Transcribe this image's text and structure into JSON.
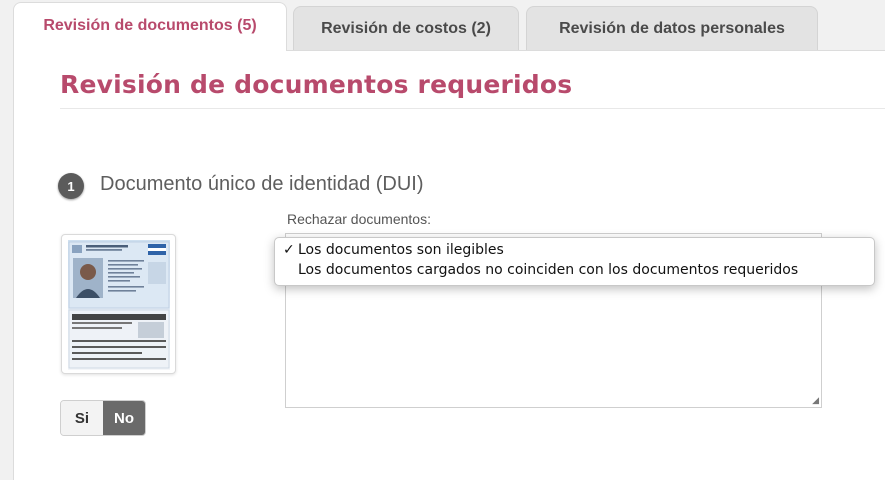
{
  "tabs": [
    {
      "label": "Revisión de documentos (5)",
      "active": true
    },
    {
      "label": "Revisión de costos (2)",
      "active": false
    },
    {
      "label": "Revisión de datos personales",
      "active": false
    }
  ],
  "page_title": "Revisión de documentos requeridos",
  "section": {
    "number": "1",
    "title": "Documento único de identidad (DUI)"
  },
  "toggle": {
    "si_label": "Si",
    "no_label": "No",
    "selected": "No"
  },
  "reject": {
    "label": "Rechazar documentos:",
    "options": [
      {
        "label": "Los documentos son ilegibles",
        "checked": true,
        "check": "✓"
      },
      {
        "label": "Los documentos cargados no coinciden con los documentos requeridos",
        "checked": false,
        "check": ""
      }
    ]
  },
  "colors": {
    "accent": "#b84a6c",
    "toggle_selected": "#6a6a6a"
  },
  "icons": {
    "textarea_resize": "resize-grip-icon"
  }
}
